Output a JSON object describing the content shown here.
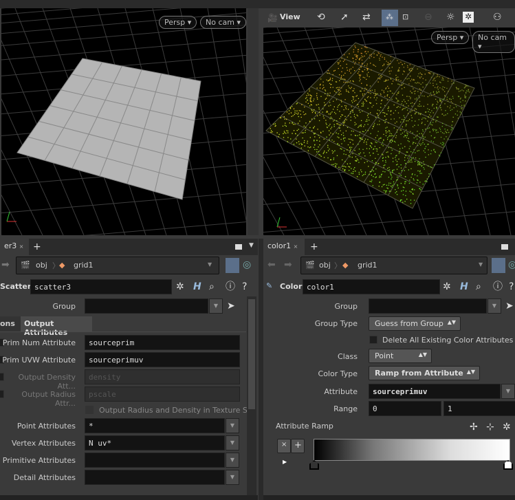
{
  "left_viewport": {
    "camera_menu": "Persp",
    "cam_menu": "No cam"
  },
  "right_viewport": {
    "toolbar": {
      "view_label": "View"
    },
    "camera_menu": "Persp",
    "cam_menu": "No cam"
  },
  "left_panel": {
    "tab_label": "er3",
    "path": {
      "root": "obj",
      "node": "grid1"
    },
    "node_type": "Scatter",
    "node_name": "scatter3",
    "group_label": "Group",
    "group_value": "",
    "tabs": [
      "ons",
      "Output Attributes"
    ],
    "params": [
      {
        "label": "Prim Num Attribute",
        "value": "sourceprim"
      },
      {
        "label": "Prim UVW Attribute",
        "value": "sourceprimuv"
      },
      {
        "label": "Output Density Att...",
        "value": "density"
      },
      {
        "label": "Output Radius Attr...",
        "value": "pscale"
      }
    ],
    "texture_space_label": "Output Radius and Density in Texture S...",
    "attr_params": [
      {
        "label": "Point Attributes",
        "value": "*"
      },
      {
        "label": "Vertex Attributes",
        "value": "N uv*"
      },
      {
        "label": "Primitive Attributes",
        "value": ""
      },
      {
        "label": "Detail Attributes",
        "value": ""
      }
    ]
  },
  "right_panel": {
    "tab_label": "color1",
    "path": {
      "root": "obj",
      "node": "grid1"
    },
    "node_type": "Color",
    "node_name": "color1",
    "group_label": "Group",
    "group_value": "",
    "group_type_label": "Group Type",
    "group_type_value": "Guess from Group",
    "delete_label": "Delete All Existing Color Attributes",
    "class_label": "Class",
    "class_value": "Point",
    "color_type_label": "Color Type",
    "color_type_value": "Ramp from Attribute",
    "attribute_label": "Attribute",
    "attribute_value": "sourceprimuv",
    "range_label": "Range",
    "range_min": "0",
    "range_max": "1",
    "ramp_label": "Attribute Ramp"
  }
}
